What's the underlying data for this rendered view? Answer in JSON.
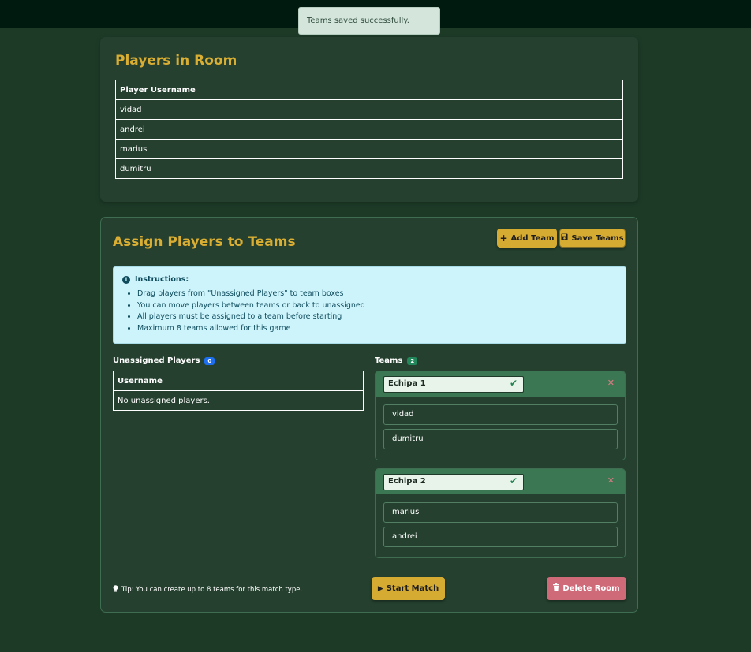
{
  "toast": {
    "message": "Teams saved successfully."
  },
  "players_card": {
    "title": "Players in Room",
    "column_header": "Player Username",
    "players": [
      "vidad",
      "andrei",
      "marius",
      "dumitru"
    ]
  },
  "assign_card": {
    "title": "Assign Players to Teams",
    "add_team_label": "Add Team",
    "save_teams_label": "Save Teams",
    "instructions": {
      "heading": "Instructions:",
      "items": [
        "Drag players from \"Unassigned Players\" to team boxes",
        "You can move players between teams or back to unassigned",
        "All players must be assigned to a team before starting",
        "Maximum 8 teams allowed for this game"
      ]
    },
    "unassigned": {
      "label": "Unassigned Players",
      "count": "0",
      "column_header": "Username",
      "empty_text": "No unassigned players."
    },
    "teams": {
      "label": "Teams",
      "count": "2",
      "list": [
        {
          "name": "Echipa 1",
          "members": [
            "vidad",
            "dumitru"
          ]
        },
        {
          "name": "Echipa 2",
          "members": [
            "marius",
            "andrei"
          ]
        }
      ]
    },
    "tip": "Tip: You can create up to 8 teams for this match type.",
    "start_match_label": "Start Match",
    "delete_room_label": "Delete Room"
  },
  "colors": {
    "background": "#1d3a27",
    "accent_yellow": "#d6ab31",
    "danger": "#cf6a78",
    "team_header": "#3c7753"
  }
}
